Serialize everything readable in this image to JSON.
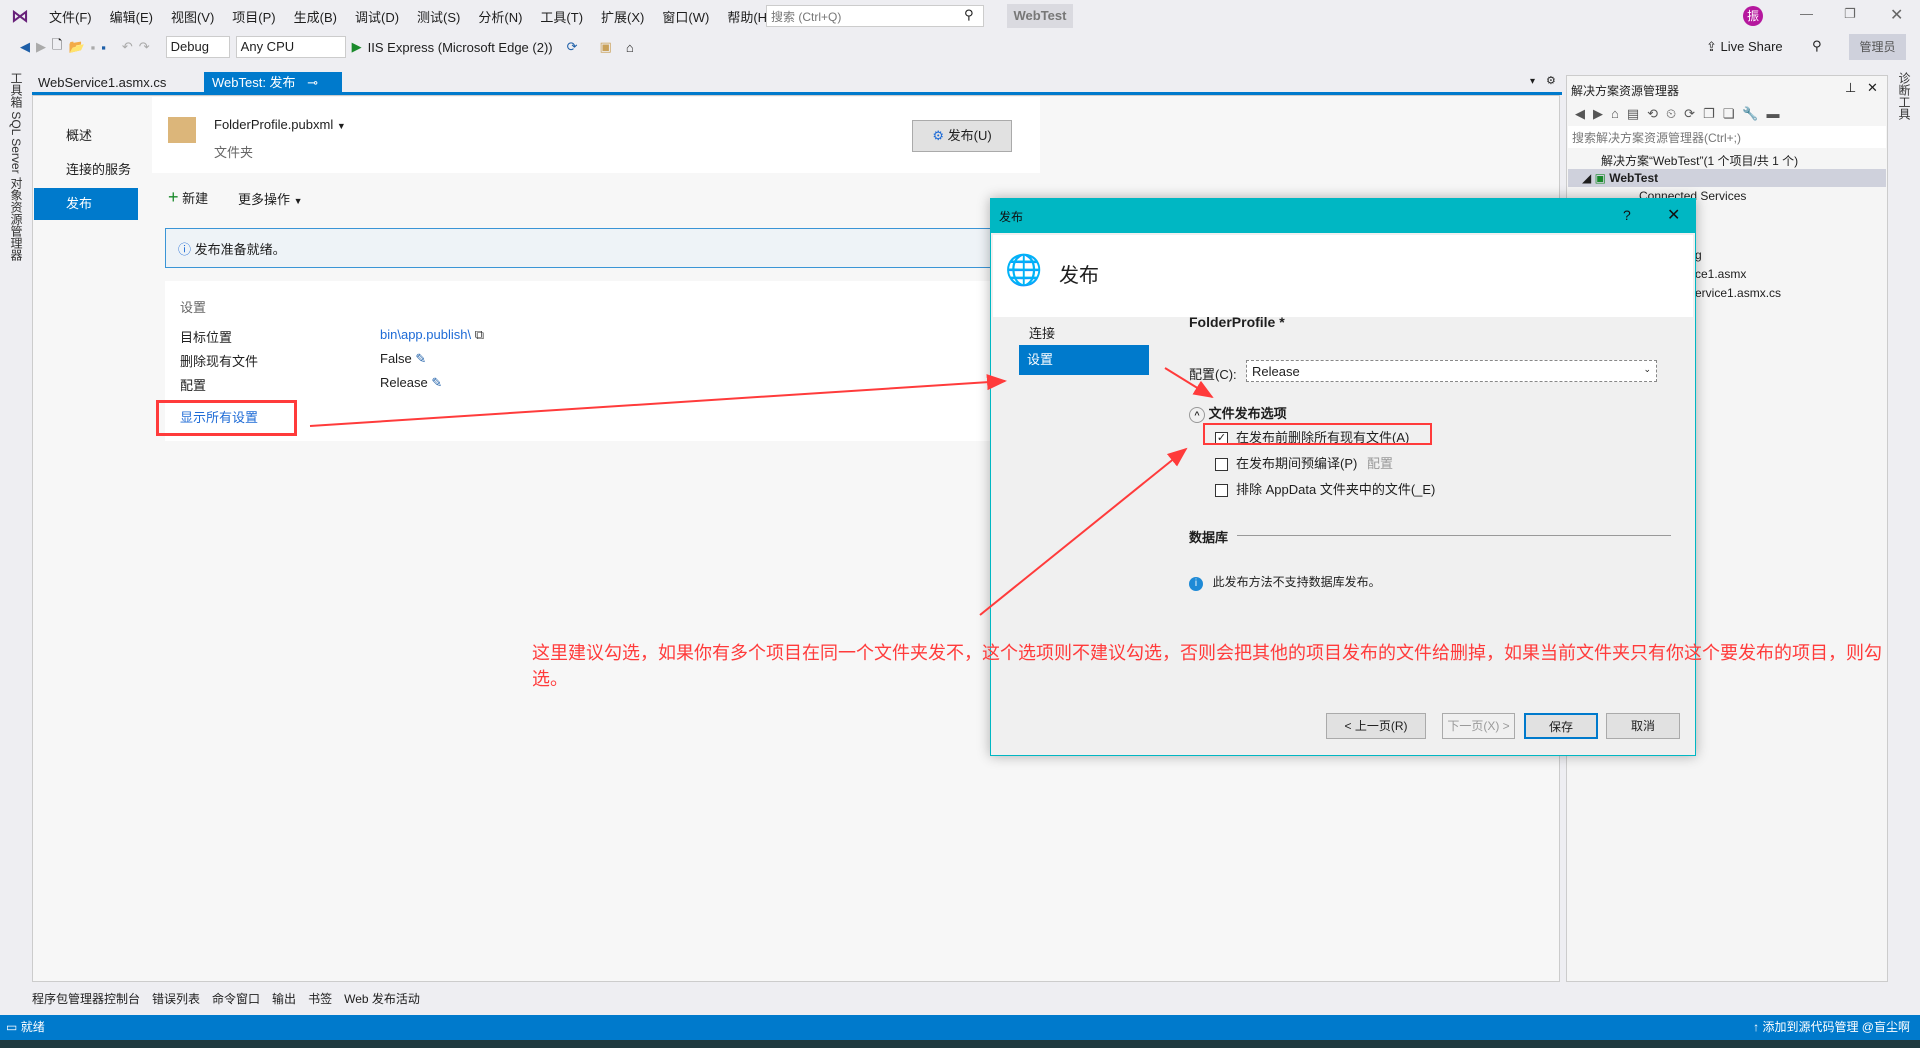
{
  "menu": [
    "文件(F)",
    "编辑(E)",
    "视图(V)",
    "项目(P)",
    "生成(B)",
    "调试(D)",
    "测试(S)",
    "分析(N)",
    "工具(T)",
    "扩展(X)",
    "窗口(W)",
    "帮助(H)"
  ],
  "search_placeholder": "搜索 (Ctrl+Q)",
  "solution_name_badge": "WebTest",
  "user_avatar": "振",
  "toolbar": {
    "config": "Debug",
    "platform": "Any CPU",
    "run": "IIS Express (Microsoft Edge (2))",
    "live_share": "Live Share",
    "admin": "管理员"
  },
  "tabs": [
    {
      "label": "WebService1.asmx.cs"
    },
    {
      "label": "WebTest: 发布"
    }
  ],
  "left_strip": "工具箱  SQL Server 对象资源管理器",
  "right_strip": "诊断工具",
  "publish_page": {
    "nav": [
      "概述",
      "连接的服务",
      "发布"
    ],
    "profile": "FolderProfile.pubxml",
    "profile_type": "文件夹",
    "publish_button": "发布(U)",
    "new": "新建",
    "more": "更多操作",
    "info": "发布准备就绪。",
    "settings_title": "设置",
    "settings": [
      {
        "label": "目标位置",
        "value": "bin\\app.publish\\"
      },
      {
        "label": "删除现有文件",
        "value": "False"
      },
      {
        "label": "配置",
        "value": "Release"
      }
    ],
    "show_all": "显示所有设置"
  },
  "solution_explorer": {
    "title": "解决方案资源管理器",
    "search_placeholder": "搜索解决方案资源管理器(Ctrl+;)",
    "items": [
      "解决方案“WebTest”(1 个项目/共 1 个)",
      "WebTest",
      "Connected Services",
      "g",
      "ce1.asmx",
      "ervice1.asmx.cs"
    ]
  },
  "dialog": {
    "title": "发布",
    "help": "?",
    "header": "发布",
    "nav": [
      "连接",
      "设置"
    ],
    "profile": "FolderProfile *",
    "config_label": "配置(C):",
    "config_value": "Release",
    "section": "文件发布选项",
    "options": [
      {
        "label": "在发布前删除所有现有文件(A)",
        "checked": true
      },
      {
        "label": "在发布期间预编译(P)",
        "checked": false,
        "extra": "配置"
      },
      {
        "label": "排除 AppData 文件夹中的文件(_E)",
        "checked": false
      }
    ],
    "db_section": "数据库",
    "db_info": "此发布方法不支持数据库发布。",
    "buttons": {
      "prev": "< 上一页(R)",
      "next": "下一页(X) >",
      "save": "保存",
      "cancel": "取消"
    }
  },
  "annotation": "这里建议勾选，如果你有多个项目在同一个文件夹发不，这个选项则不建议勾选，否则会把其他的项目发布的文件给删掉，如果当前文件夹只有你这个要发布的项目，则勾选。",
  "bottom_tabs": [
    "程序包管理器控制台",
    "错误列表",
    "命令窗口",
    "输出",
    "书签",
    "Web 发布活动"
  ],
  "status": {
    "left": "就绪",
    "right": "添加到源代码管理 @盲尘啊"
  },
  "colors": {
    "accent": "#007acc",
    "dialog_title": "#00b7c3",
    "annotation": "#ff3b3b"
  }
}
